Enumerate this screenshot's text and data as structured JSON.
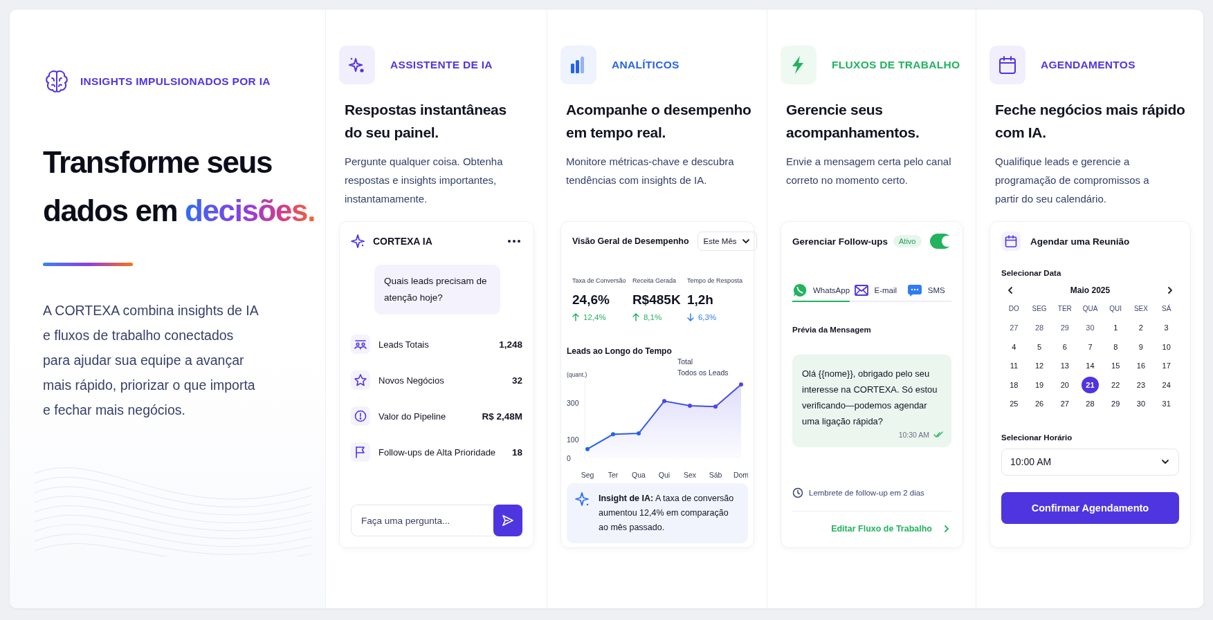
{
  "intro": {
    "eyebrow": "INSIGHTS IMPULSIONADOS POR IA",
    "heading": "Transforme seus dados em",
    "heading_accent": "decisões.",
    "body": "A CORTEXA combina insights de IA e fluxos de trabalho conectados para ajudar sua equipe a avançar mais rápido, priorizar o que importa e fechar mais negócios."
  },
  "features": [
    {
      "kind": "assistant",
      "color": "#4f35e0",
      "category": "ASSISTENTE DE IA",
      "title": "Respostas instantâneas do seu painel.",
      "description": "Pergunte qualquer coisa. Obtenha respostas e insights importantes, instantamamente.",
      "panel": {
        "title": "CORTEXA IA",
        "question": "Quais leads precisam de atenção hoje?",
        "stats": [
          {
            "label": "Leads Totais",
            "value": "1,248"
          },
          {
            "label": "Novos Negócios",
            "value": "32"
          },
          {
            "label": "Valor do Pipeline",
            "value": "R$ 2,48M"
          },
          {
            "label": "Follow-ups de Alta Prioridade",
            "value": "18"
          }
        ],
        "input": {
          "placeholder": "Faça uma pergunta..."
        }
      }
    },
    {
      "kind": "analytics",
      "color": "#2563eb",
      "category": "ANALÍTICOS",
      "title": "Acompanhe o desempenho em tempo real.",
      "description": "Monitore métricas-chave e descubra tendências com insights de IA.",
      "panel": {
        "title": "Visão Geral de Desempenho",
        "period": "Este Mês",
        "metrics": [
          {
            "label": "Taxa de Conversão",
            "value": "24,6%",
            "change": "12,4%",
            "kind": "up"
          },
          {
            "label": "Receita Gerada",
            "value": "R$485K",
            "change": "8,1%",
            "kind": "up"
          },
          {
            "label": "Tempo de Resposta",
            "value": "1,2h",
            "change": "6,3%",
            "kind": "down"
          }
        ],
        "chart_title": "Leads ao Longo do Tempo",
        "chart_data": {
          "type": "area",
          "ylabel": "(quant.)",
          "categories": [
            "Seg",
            "Ter",
            "Qua",
            "Qui",
            "Sex",
            "Sáb",
            "Dom"
          ],
          "series": [
            {
              "name": "Total Todos os Leads",
              "color": "#4f46e5",
              "values": [
                50,
                130,
                135,
                310,
                285,
                280,
                400
              ]
            }
          ],
          "ylim": [
            0,
            420
          ],
          "yticks": [
            0,
            100,
            300
          ]
        },
        "insight": "**Insight de IA:** A taxa de conversão aumentou 12,4% em comparação ao mês passado."
      }
    },
    {
      "kind": "workflow",
      "color": "#22b35e",
      "category": "FLUXOS DE TRABALHO",
      "title": "Gerencie seus acompanhamentos.",
      "description": "Envie a mensagem certa pelo canal correto no momento certo.",
      "panel": {
        "title": "Gerenciar Follow-ups",
        "badge": "Ativo",
        "on": true,
        "channels": [
          {
            "label": "WhatsApp",
            "selected": true
          },
          {
            "label": "E-mail",
            "selected": false
          },
          {
            "label": "SMS",
            "selected": false
          }
        ],
        "preview_label": "Prévia da Mensagem",
        "message": "Olá {{nome}}, obrigado pelo seu interesse na CORTEXA. Só estou verificando—podemos agendar uma ligação rápida?",
        "time": "10:30 AM",
        "read": true,
        "reminder": "Lembrete de follow-up em 2 dias",
        "link": "Editar Fluxo de Trabalho"
      }
    },
    {
      "kind": "scheduling",
      "color": "#4f35e0",
      "category": "AGENDAMENTOS",
      "title": "Feche negócios mais rápido com IA.",
      "description": "Qualifique leads e gerencie a programação de compromissos a partir do seu calendário.",
      "panel": {
        "title": "Agendar uma Reunião",
        "date_label": "Selecionar Data",
        "month": "Maio 2025",
        "weekdays": [
          "DO",
          "SEG",
          "TER",
          "QUA",
          "QUI",
          "SEX",
          "SÁ"
        ],
        "days": [
          {
            "label": "27",
            "outside": true,
            "selected": false
          },
          {
            "label": "28",
            "outside": true,
            "selected": false
          },
          {
            "label": "29",
            "outside": true,
            "selected": false
          },
          {
            "label": "30",
            "outside": true,
            "selected": false
          },
          {
            "label": "1",
            "outside": false,
            "selected": false
          },
          {
            "label": "2",
            "outside": false,
            "selected": false
          },
          {
            "label": "3",
            "outside": false,
            "selected": false
          },
          {
            "label": "4",
            "outside": false,
            "selected": false
          },
          {
            "label": "5",
            "outside": false,
            "selected": false
          },
          {
            "label": "6",
            "outside": false,
            "selected": false
          },
          {
            "label": "7",
            "outside": false,
            "selected": false
          },
          {
            "label": "8",
            "outside": false,
            "selected": false
          },
          {
            "label": "9",
            "outside": false,
            "selected": false
          },
          {
            "label": "10",
            "outside": false,
            "selected": false
          },
          {
            "label": "11",
            "outside": false,
            "selected": false
          },
          {
            "label": "12",
            "outside": false,
            "selected": false
          },
          {
            "label": "13",
            "outside": false,
            "selected": false
          },
          {
            "label": "14",
            "outside": false,
            "selected": false
          },
          {
            "label": "15",
            "outside": false,
            "selected": false
          },
          {
            "label": "16",
            "outside": false,
            "selected": false
          },
          {
            "label": "17",
            "outside": false,
            "selected": false
          },
          {
            "label": "18",
            "outside": false,
            "selected": false
          },
          {
            "label": "19",
            "outside": false,
            "selected": false
          },
          {
            "label": "20",
            "outside": false,
            "selected": false
          },
          {
            "label": "21",
            "outside": false,
            "selected": true
          },
          {
            "label": "22",
            "outside": false,
            "selected": false
          },
          {
            "label": "23",
            "outside": false,
            "selected": false
          },
          {
            "label": "24",
            "outside": false,
            "selected": false
          },
          {
            "label": "25",
            "outside": false,
            "selected": false
          },
          {
            "label": "26",
            "outside": false,
            "selected": false
          },
          {
            "label": "27",
            "outside": false,
            "selected": false
          },
          {
            "label": "28",
            "outside": false,
            "selected": false
          },
          {
            "label": "29",
            "outside": false,
            "selected": false
          },
          {
            "label": "30",
            "outside": false,
            "selected": false
          },
          {
            "label": "31",
            "outside": false,
            "selected": false
          }
        ],
        "time_label": "Selecionar Horário",
        "time_value": "10:00 AM",
        "button": "Confirmar Agendamento"
      }
    }
  ]
}
